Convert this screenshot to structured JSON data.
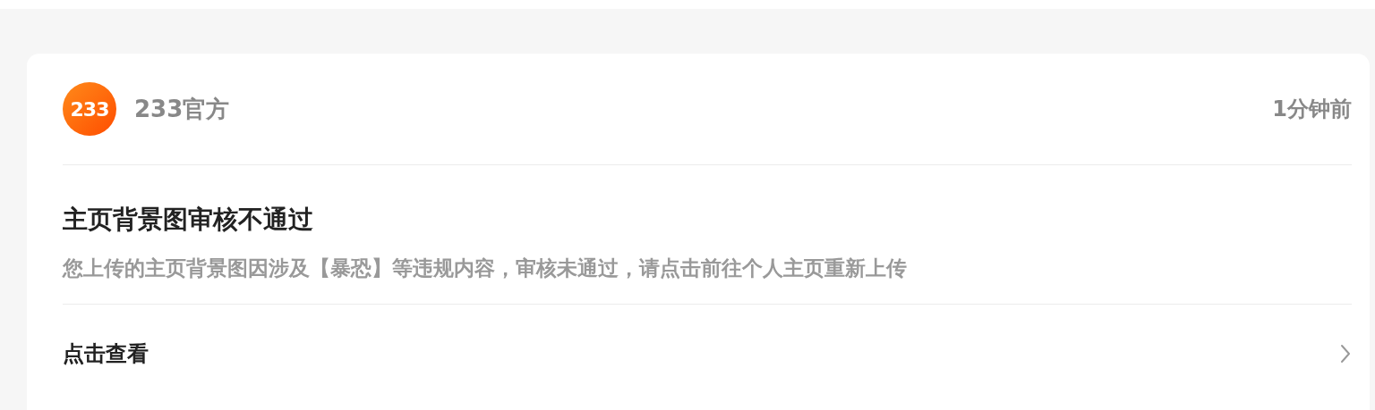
{
  "message": {
    "avatar_text": "233",
    "sender": "233官方",
    "time": "1分钟前",
    "title": "主页背景图审核不通过",
    "body": "您上传的主页背景图因涉及【暴恐】等违规内容，审核未通过，请点击前往个人主页重新上传",
    "action": "点击查看"
  }
}
